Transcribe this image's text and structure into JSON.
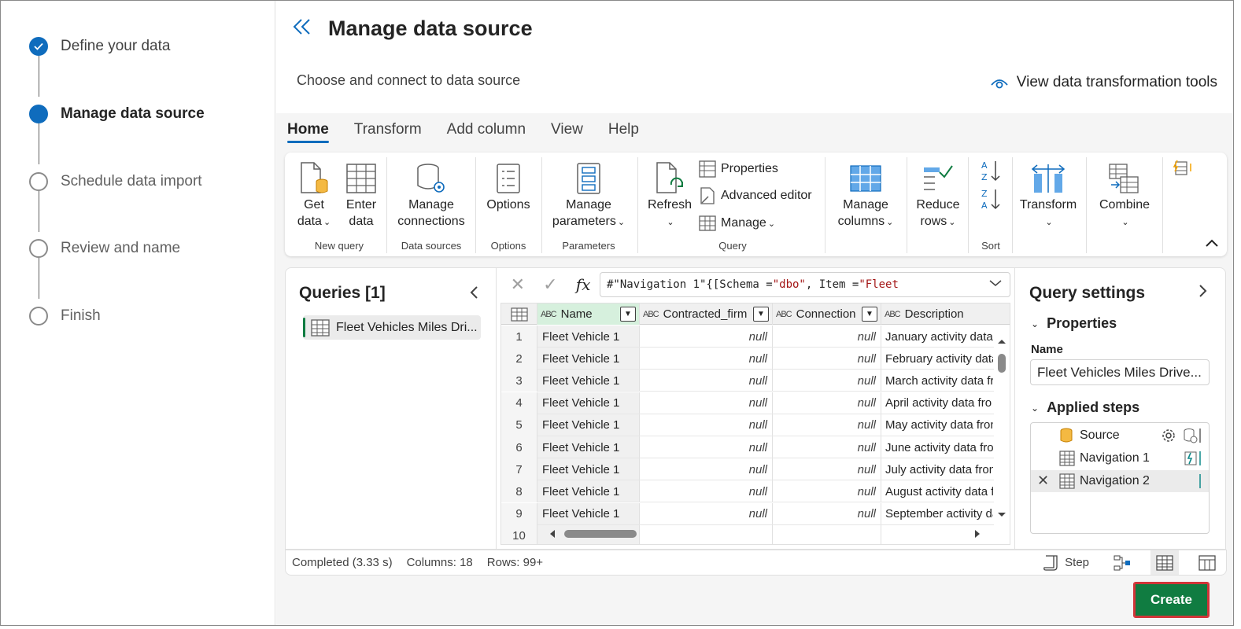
{
  "wizard": {
    "steps": [
      {
        "label": "Define your data",
        "state": "done"
      },
      {
        "label": "Manage data source",
        "state": "current"
      },
      {
        "label": "Schedule data import",
        "state": "future"
      },
      {
        "label": "Review and name",
        "state": "future"
      },
      {
        "label": "Finish",
        "state": "future"
      }
    ]
  },
  "header": {
    "title": "Manage data source",
    "subtitle": "Choose and connect to data source",
    "view_tools": "View data transformation tools"
  },
  "tabs": [
    "Home",
    "Transform",
    "Add column",
    "View",
    "Help"
  ],
  "ribbon": {
    "get_data": [
      "Get",
      "data"
    ],
    "enter_data": [
      "Enter",
      "data"
    ],
    "group_new_query": "New query",
    "manage_connections": [
      "Manage",
      "connections"
    ],
    "group_data_sources": "Data sources",
    "options": "Options",
    "group_options": "Options",
    "manage_parameters": [
      "Manage",
      "parameters"
    ],
    "group_parameters": "Parameters",
    "refresh": "Refresh",
    "properties": "Properties",
    "advanced_editor": "Advanced editor",
    "manage": "Manage",
    "group_query": "Query",
    "manage_columns": [
      "Manage",
      "columns"
    ],
    "reduce_rows": [
      "Reduce",
      "rows"
    ],
    "group_sort": "Sort",
    "transform": "Transform",
    "combine": "Combine"
  },
  "queries": {
    "title": "Queries [1]",
    "item": "Fleet Vehicles Miles Dri..."
  },
  "formula": {
    "prefix": "#\"Navigation 1\"{[Schema = ",
    "schema": "\"dbo\"",
    "mid": ", Item = ",
    "item": "\"Fleet"
  },
  "grid": {
    "columns": [
      {
        "type": "ABC",
        "name": "Name"
      },
      {
        "type": "ABC",
        "name": "Contracted_firm"
      },
      {
        "type": "ABC",
        "name": "Connection"
      },
      {
        "type": "ABC",
        "name": "Description"
      }
    ],
    "rows": [
      {
        "n": "1",
        "name": "Fleet Vehicle 1",
        "firm": "null",
        "conn": "null",
        "desc": "January activity data"
      },
      {
        "n": "2",
        "name": "Fleet Vehicle 1",
        "firm": "null",
        "conn": "null",
        "desc": "February activity data"
      },
      {
        "n": "3",
        "name": "Fleet Vehicle 1",
        "firm": "null",
        "conn": "null",
        "desc": "March activity data fr"
      },
      {
        "n": "4",
        "name": "Fleet Vehicle 1",
        "firm": "null",
        "conn": "null",
        "desc": "April activity data fro"
      },
      {
        "n": "5",
        "name": "Fleet Vehicle 1",
        "firm": "null",
        "conn": "null",
        "desc": "May activity data fron"
      },
      {
        "n": "6",
        "name": "Fleet Vehicle 1",
        "firm": "null",
        "conn": "null",
        "desc": "June activity data fro"
      },
      {
        "n": "7",
        "name": "Fleet Vehicle 1",
        "firm": "null",
        "conn": "null",
        "desc": "July activity data from"
      },
      {
        "n": "8",
        "name": "Fleet Vehicle 1",
        "firm": "null",
        "conn": "null",
        "desc": "August activity data f"
      },
      {
        "n": "9",
        "name": "Fleet Vehicle 1",
        "firm": "null",
        "conn": "null",
        "desc": "September activity da"
      },
      {
        "n": "10",
        "name": "",
        "firm": "",
        "conn": "",
        "desc": ""
      }
    ]
  },
  "settings": {
    "title": "Query settings",
    "properties": "Properties",
    "name_label": "Name",
    "name_value": "Fleet Vehicles Miles Drive...",
    "applied_steps": "Applied steps",
    "steps": [
      "Source",
      "Navigation 1",
      "Navigation 2"
    ]
  },
  "status": {
    "completed": "Completed (3.33 s)",
    "columns": "Columns: 18",
    "rows": "Rows: 99+",
    "step": "Step"
  },
  "create_label": "Create",
  "colors": {
    "accent": "#0f6cbd",
    "create": "#107c41",
    "create_border": "#d13438"
  }
}
